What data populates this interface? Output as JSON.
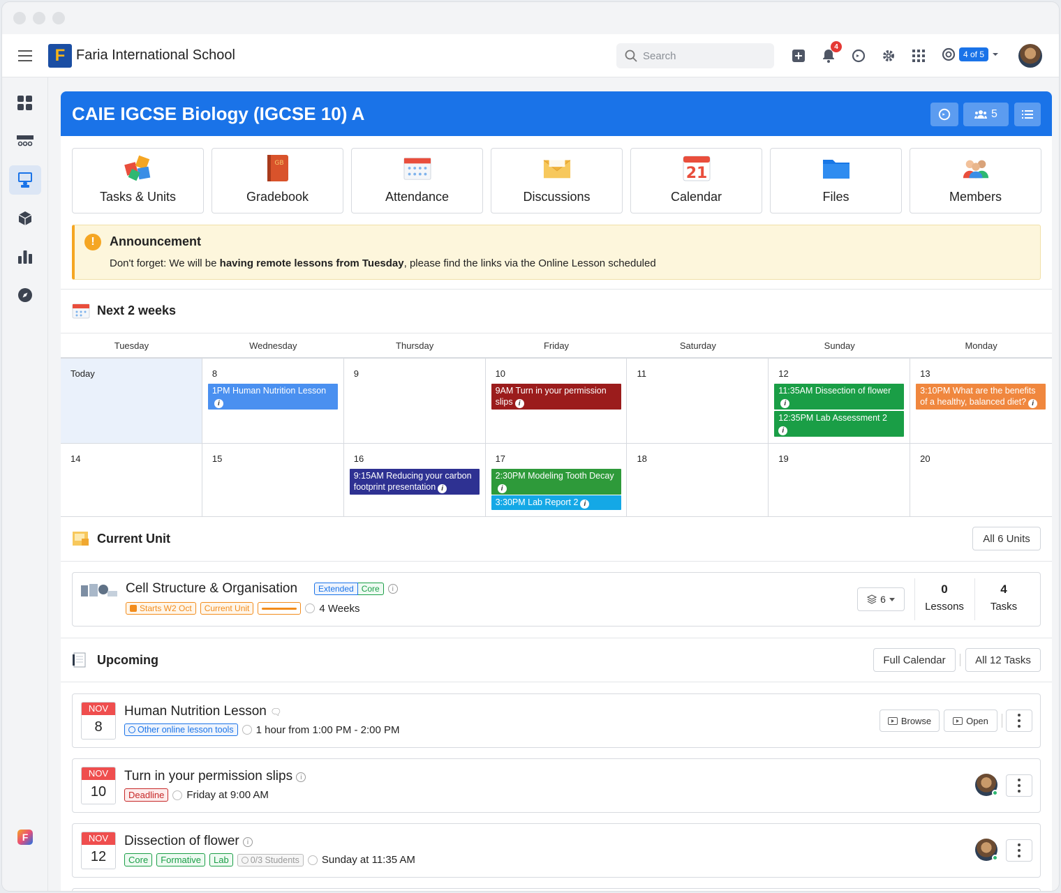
{
  "app": {
    "school_name": "Faria International School",
    "logo_letter": "F"
  },
  "topbar": {
    "search_placeholder": "Search",
    "notification_count": "4",
    "switcher_label": "4 of 5"
  },
  "class": {
    "title": "CAIE IGCSE Biology (IGCSE 10) A",
    "member_count": "5"
  },
  "tiles": [
    {
      "label": "Tasks & Units",
      "icon": "puzzle-icon"
    },
    {
      "label": "Gradebook",
      "icon": "gradebook-icon",
      "badge": "GB"
    },
    {
      "label": "Attendance",
      "icon": "attendance-icon"
    },
    {
      "label": "Discussions",
      "icon": "envelope-icon"
    },
    {
      "label": "Calendar",
      "icon": "calendar-icon",
      "day": "21"
    },
    {
      "label": "Files",
      "icon": "folder-icon"
    },
    {
      "label": "Members",
      "icon": "members-icon"
    }
  ],
  "announcement": {
    "title": "Announcement",
    "text_before": "Don't forget: We will be ",
    "text_bold": "having remote lessons from Tuesday",
    "text_after": ", please find the links via the Online Lesson scheduled"
  },
  "next_weeks": {
    "title": "Next 2 weeks",
    "days": [
      "Tuesday",
      "Wednesday",
      "Thursday",
      "Friday",
      "Saturday",
      "Sunday",
      "Monday"
    ],
    "week1": [
      {
        "date": "Today",
        "events": []
      },
      {
        "date": "8",
        "events": [
          {
            "text": "1PM Human Nutrition Lesson",
            "color": "#4a90f0"
          }
        ]
      },
      {
        "date": "9",
        "events": []
      },
      {
        "date": "10",
        "events": [
          {
            "text": "9AM Turn in your permission slips",
            "color": "#9b1c1c"
          }
        ]
      },
      {
        "date": "11",
        "events": []
      },
      {
        "date": "12",
        "events": [
          {
            "text": "11:35AM Dissection of flower",
            "color": "#1a9e46"
          },
          {
            "text": "12:35PM Lab Assessment 2",
            "color": "#1a9e46"
          }
        ]
      },
      {
        "date": "13",
        "events": [
          {
            "text": "3:10PM What are the benefits of a healthy, balanced diet?",
            "color": "#f0873e"
          }
        ]
      }
    ],
    "week2": [
      {
        "date": "14",
        "events": []
      },
      {
        "date": "15",
        "events": []
      },
      {
        "date": "16",
        "events": [
          {
            "text": "9:15AM Reducing your carbon footprint presentation",
            "color": "#2e3192"
          }
        ]
      },
      {
        "date": "17",
        "events": [
          {
            "text": "2:30PM Modeling Tooth Decay",
            "color": "#2e9a3a"
          },
          {
            "text": "3:30PM Lab Report 2",
            "color": "#14a8e6"
          }
        ]
      },
      {
        "date": "18",
        "events": []
      },
      {
        "date": "19",
        "events": []
      },
      {
        "date": "20",
        "events": []
      }
    ]
  },
  "current_unit": {
    "title": "Current Unit",
    "all_units_label": "All 6 Units",
    "unit_name": "Cell Structure & Organisation",
    "tag_extended": "Extended",
    "tag_core": "Core",
    "tag_starts": "Starts W2 Oct",
    "tag_current": "Current Unit",
    "duration": "4 Weeks",
    "layers_count": "6",
    "lessons_count": "0",
    "lessons_label": "Lessons",
    "tasks_count": "4",
    "tasks_label": "Tasks",
    "progress": 1.0
  },
  "upcoming": {
    "title": "Upcoming",
    "full_calendar_label": "Full Calendar",
    "all_tasks_label": "All 12 Tasks",
    "items": [
      {
        "month": "NOV",
        "day": "8",
        "title": "Human Nutrition Lesson",
        "tag": "Other online lesson tools",
        "time": "1 hour from 1:00 PM - 2:00 PM",
        "browse": "Browse",
        "open": "Open"
      },
      {
        "month": "NOV",
        "day": "10",
        "title": "Turn in your permission slips",
        "tag": "Deadline",
        "time": "Friday at 9:00 AM"
      },
      {
        "month": "NOV",
        "day": "12",
        "title": "Dissection of flower",
        "tags": [
          "Core",
          "Formative",
          "Lab"
        ],
        "students": "0/3 Students",
        "time": "Sunday at 11:35 AM"
      }
    ]
  },
  "colors": {
    "primary": "#1a73e8",
    "announcement_bg": "#fdf6dc",
    "accent_orange": "#f5a623"
  }
}
